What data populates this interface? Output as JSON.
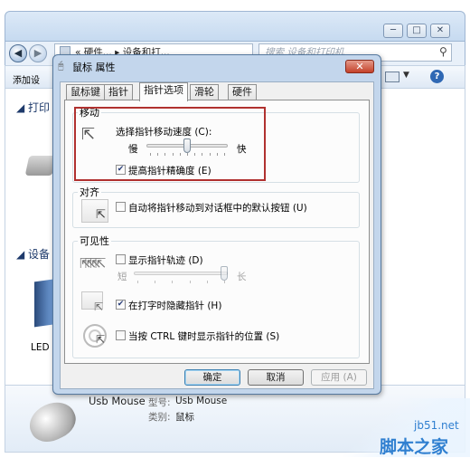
{
  "explorer": {
    "address_text": "« 硬件... ▸ 设备和打...",
    "search_placeholder": "搜索 设备和打印机",
    "toolbar_add": "添加设",
    "section_printers": "◢ 打印",
    "section_devices": "◢ 设备",
    "led_label": "LED",
    "device_name": "Usb Mouse",
    "device_model_label": "型号:",
    "device_model_value": "Usb Mouse",
    "device_category_label": "类别:",
    "device_category_value": "鼠标"
  },
  "dialog": {
    "title": "鼠标 属性",
    "close_glyph": "✕",
    "tabs": [
      "鼠标键",
      "指针",
      "指针选项",
      "滑轮",
      "硬件"
    ],
    "active_tab": 2,
    "motion": {
      "group_label": "移动",
      "speed_label": "选择指针移动速度 (C):",
      "slow": "慢",
      "fast": "快",
      "speed_value": 0.5,
      "precision_label": "提高指针精确度 (E)",
      "precision_checked": true
    },
    "snap": {
      "group_label": "对齐",
      "label": "自动将指针移动到对话框中的默认按钮 (U)",
      "checked": false
    },
    "visibility": {
      "group_label": "可见性",
      "trails_label": "显示指针轨迹 (D)",
      "trails_checked": false,
      "short": "短",
      "long": "长",
      "trails_value": 1.0,
      "hide_label": "在打字时隐藏指针 (H)",
      "hide_checked": true,
      "ctrl_label": "当按 CTRL 键时显示指针的位置 (S)",
      "ctrl_checked": false
    },
    "buttons": {
      "ok": "确定",
      "cancel": "取消",
      "apply": "应用 (A)"
    }
  },
  "watermark": {
    "site": "jb51.net",
    "brand": "脚本之家"
  },
  "colors": {
    "highlight_border": "#b0312f",
    "watermark": "#2f7fd0",
    "close_button": "#c4412a"
  }
}
